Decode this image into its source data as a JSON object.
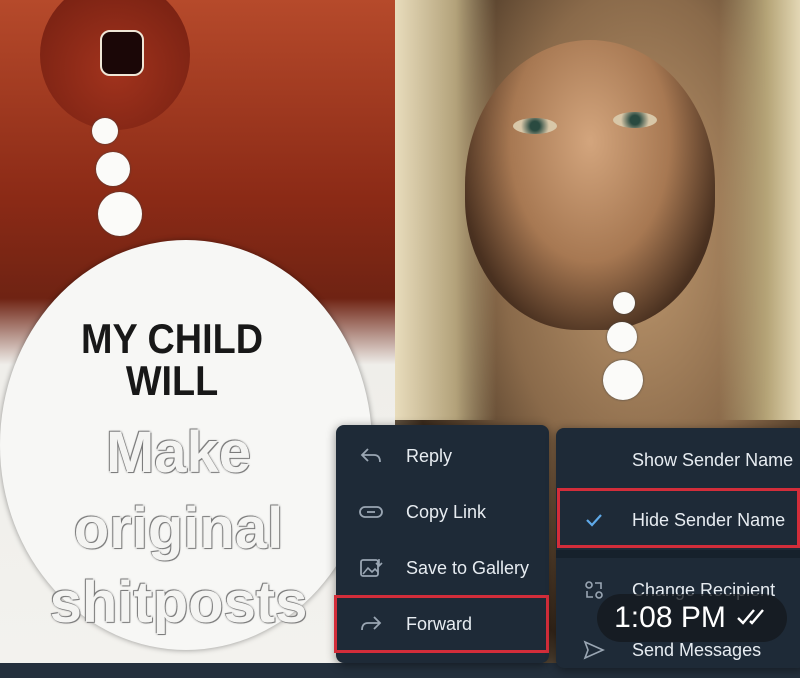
{
  "meme": {
    "bubble_line1": "MY CHILD",
    "bubble_line2": "WILL",
    "overlay_line1": "Make",
    "overlay_line2": "original",
    "overlay_line3": "shitposts"
  },
  "context_menu": {
    "items": [
      {
        "label": "Reply",
        "icon": "reply-icon"
      },
      {
        "label": "Copy Link",
        "icon": "link-icon"
      },
      {
        "label": "Save to Gallery",
        "icon": "save-to-gallery-icon"
      },
      {
        "label": "Forward",
        "icon": "forward-icon"
      }
    ]
  },
  "forward_options": {
    "show_sender": "Show Sender Name",
    "hide_sender": "Hide Sender Name",
    "hide_sender_checked": true,
    "change_recipient": "Change Recipient",
    "send_messages": "Send Messages"
  },
  "message": {
    "time": "1:08 PM",
    "status_icon": "double-check-icon"
  },
  "colors": {
    "menu_bg": "#1e2a37",
    "highlight": "#d32d3a",
    "accent": "#5fa9e8"
  }
}
